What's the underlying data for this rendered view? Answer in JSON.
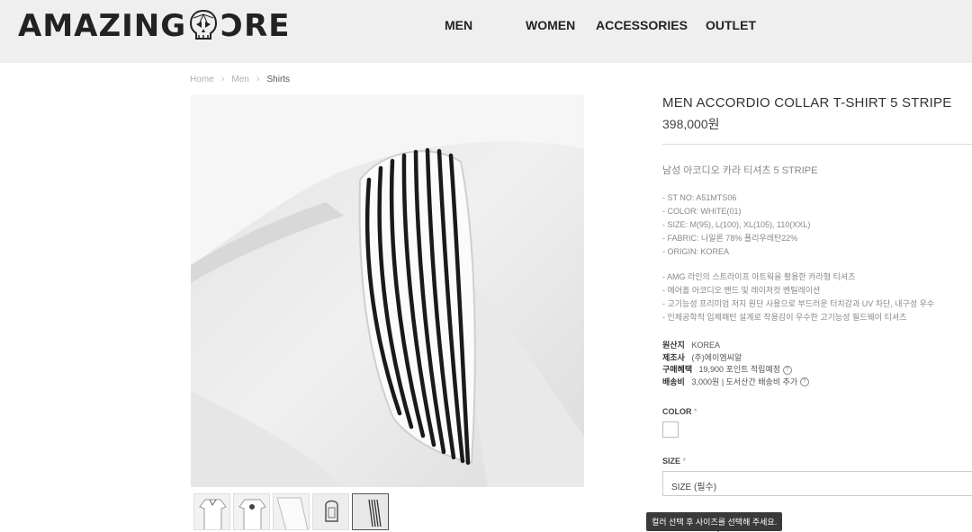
{
  "header": {
    "logo_left": "AMAZING",
    "logo_right": "RE",
    "logo_icon": "skull-icon",
    "nav": [
      {
        "label": "MEN"
      },
      {
        "label": "WOMEN"
      },
      {
        "label": "ACCESSORIES"
      },
      {
        "label": "OUTLET"
      }
    ]
  },
  "breadcrumb": {
    "items": [
      "Home",
      "Men",
      "Shirts"
    ],
    "separator": ">"
  },
  "product": {
    "title": "MEN ACCORDIO COLLAR T-SHIRT 5 STRIPE",
    "price": "398,000원",
    "subtitle": "남성 아코디오 카라 티셔츠 5 STRIPE",
    "specs": [
      "- ST NO: A51MTS06",
      "- COLOR: WHITE(01)",
      "- SIZE: M(95), L(100), XL(105), 110(XXL)",
      "- FABRIC: 나일론 78% 폴리우레탄22%",
      "- ORIGIN: KOREA"
    ],
    "features": [
      "- AMG 라인의 스트라이프 아트웍을 활용한 카라형 티셔츠",
      "- 에어홀 아코디오 밴드 및 레이저컷 벤틸레이션",
      "- 고기능성 프리미엄 저지 원단 사용으로 부드러운 터치감과 UV 차단, 내구성 우수",
      "- 인체공학적 입체패턴 설계로 착용감이 우수한 고기능성 필드웨어 티셔츠"
    ],
    "meta": {
      "origin_label": "원산지",
      "origin_value": "KOREA",
      "maker_label": "제조사",
      "maker_value": "(주)에이엠씨알",
      "benefit_label": "구매혜택",
      "benefit_value": "19,900 포인트 적립예정",
      "shipping_label": "배송비",
      "shipping_value": "3,000원  |  도서산간 배송비 추가"
    },
    "color_label": "COLOR",
    "size_label": "SIZE",
    "required_mark": "*",
    "size_placeholder": "SIZE (필수)",
    "tooltip": "컬러 선택 후 사이즈를 선택해 주세요.",
    "swatch_color": "#ffffff"
  },
  "thumbnails": [
    "front",
    "back",
    "sleeve",
    "logo-back",
    "stripe-detail"
  ],
  "colors": {
    "header_bg": "#efefef",
    "stripe": "#1a1a1a"
  }
}
